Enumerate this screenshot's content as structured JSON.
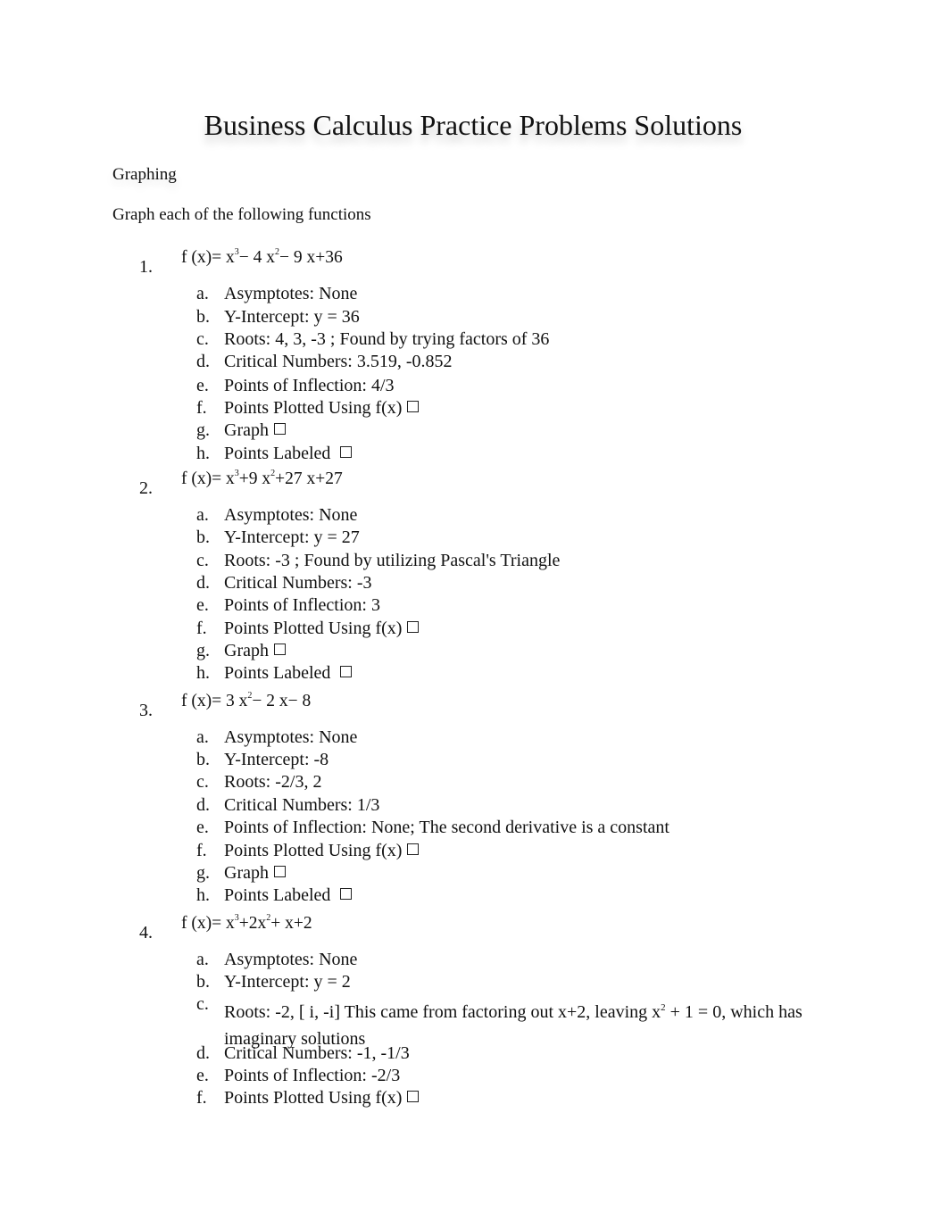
{
  "document": {
    "title": "Business Calculus Practice Problems Solutions",
    "section_heading": "Graphing",
    "instructions": "Graph each of the following functions",
    "problems": [
      {
        "number": "1.",
        "formula": {
          "prefix": "f (x)= x",
          "p1": "3",
          "mid1": "− 4 x",
          "p2": "2",
          "rest": "− 9 x+36"
        },
        "items": [
          {
            "label": "a.",
            "text": " Asymptotes: None"
          },
          {
            "label": "b.",
            "text": "Y-Intercept: y = 36"
          },
          {
            "label": "c.",
            "text": "Roots: 4, 3, -3 ; Found by trying factors of 36"
          },
          {
            "label": "d.",
            "text": "Critical Numbers: 3.519, -0.852"
          },
          {
            "label": "e.",
            "text": "Points of Inflection: 4/3"
          },
          {
            "label": "f.",
            "text": "Points Plotted Using f(x)",
            "checkbox": true
          },
          {
            "label": "g.",
            "text": "Graph",
            "checkbox": true
          },
          {
            "label": "h.",
            "text": "Points Labeled ",
            "checkbox": true
          }
        ]
      },
      {
        "number": "2.",
        "formula": {
          "prefix": "f (x)= x",
          "p1": "3",
          "mid1": "+9 x",
          "p2": "2",
          "rest": "+27 x+27"
        },
        "items": [
          {
            "label": "a.",
            "text": "Asymptotes: None"
          },
          {
            "label": "b.",
            "text": "Y-Intercept: y = 27"
          },
          {
            "label": "c.",
            "text": "Roots: -3 ; Found by utilizing Pascal's Triangle"
          },
          {
            "label": "d.",
            "text": "Critical Numbers: -3"
          },
          {
            "label": "e.",
            "text": "Points of Inflection: 3"
          },
          {
            "label": "f.",
            "text": "Points Plotted Using f(x)",
            "checkbox": true
          },
          {
            "label": "g.",
            "text": "Graph",
            "checkbox": true
          },
          {
            "label": "h.",
            "text": "Points Labeled ",
            "checkbox": true
          }
        ]
      },
      {
        "number": "3.",
        "formula": {
          "prefix": "f (x)= 3 x",
          "p1": "2",
          "mid1": "− 2 x− 8",
          "p2": "",
          "rest": ""
        },
        "items": [
          {
            "label": "a.",
            "text": "Asymptotes: None"
          },
          {
            "label": "b.",
            "text": "Y-Intercept: -8"
          },
          {
            "label": "c.",
            "text": "Roots: -2/3, 2"
          },
          {
            "label": "d.",
            "text": "Critical Numbers: 1/3"
          },
          {
            "label": "e.",
            "text": "Points of Inflection: None; The second derivative is a constant"
          },
          {
            "label": "f.",
            "text": "Points Plotted Using f(x)",
            "checkbox": true
          },
          {
            "label": "g.",
            "text": "Graph",
            "checkbox": true
          },
          {
            "label": "h.",
            "text": "Points Labeled ",
            "checkbox": true
          }
        ]
      },
      {
        "number": "4.",
        "formula": {
          "prefix": "f (x)= x",
          "p1": "3",
          "mid1": "+2x",
          "p2": "2",
          "rest": "+ x+2"
        },
        "items": [
          {
            "label": "a.",
            "text": "Asymptotes: None"
          },
          {
            "label": "b.",
            "text": "Y-Intercept: y = 2"
          },
          {
            "label": "c.",
            "text_pre": "Roots:  -2, [ i, -i] This came from factoring out x+2, leaving x",
            "sup": "2",
            "text_post": " + 1 = 0, which has imaginary solutions",
            "wrap": true
          },
          {
            "label": "d.",
            "text": "Critical Numbers: -1, -1/3"
          },
          {
            "label": "e.",
            "text": "Points of Inflection: -2/3"
          },
          {
            "label": "f.",
            "text": "Points Plotted Using f(x)",
            "checkbox": true
          }
        ]
      }
    ]
  }
}
